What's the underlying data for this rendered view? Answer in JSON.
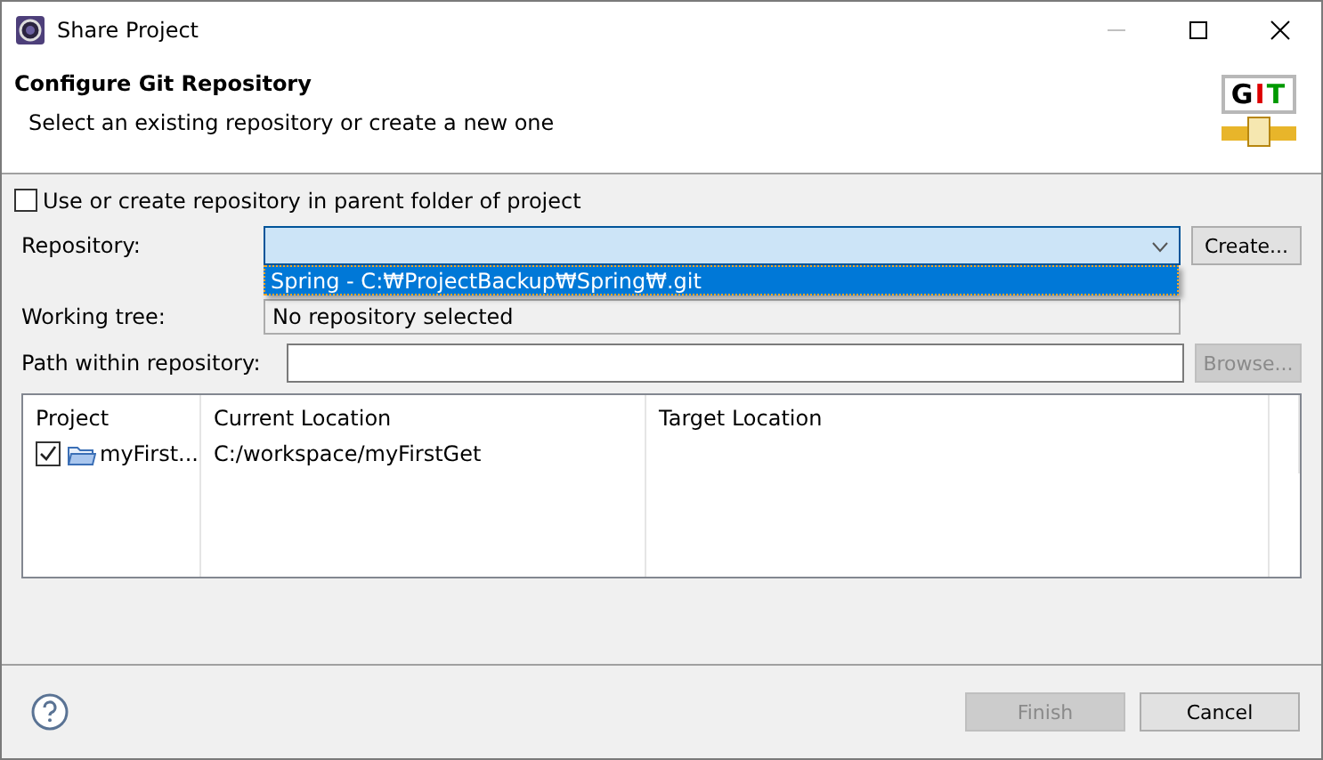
{
  "window": {
    "title": "Share Project"
  },
  "header": {
    "title": "Configure Git Repository",
    "subtitle": "Select an existing repository or create a new one",
    "logo": "GIT"
  },
  "parent_folder": {
    "label": "Use or create repository in parent folder of project",
    "checked": false
  },
  "repository": {
    "label": "Repository:",
    "focused": true,
    "button": {
      "label": "Create...",
      "disabled": false
    },
    "dropdown": [
      {
        "label": "Spring - C:₩ProjectBackup₩Spring₩.git",
        "selected": true
      }
    ]
  },
  "working_tree": {
    "label": "Working tree:",
    "value": "No repository selected"
  },
  "path": {
    "label": "Path within repository:",
    "button": {
      "label": "Browse...",
      "disabled": true
    }
  },
  "table": {
    "columns": [
      "Project",
      "Current Location",
      "Target Location"
    ],
    "rows": [
      {
        "checked": true,
        "project": "myFirst...",
        "current_location": "C:/workspace/myFirstGet"
      }
    ]
  },
  "buttons": [
    {
      "label": "Finish",
      "disabled": true
    },
    {
      "label": "Cancel",
      "disabled": false
    }
  ]
}
